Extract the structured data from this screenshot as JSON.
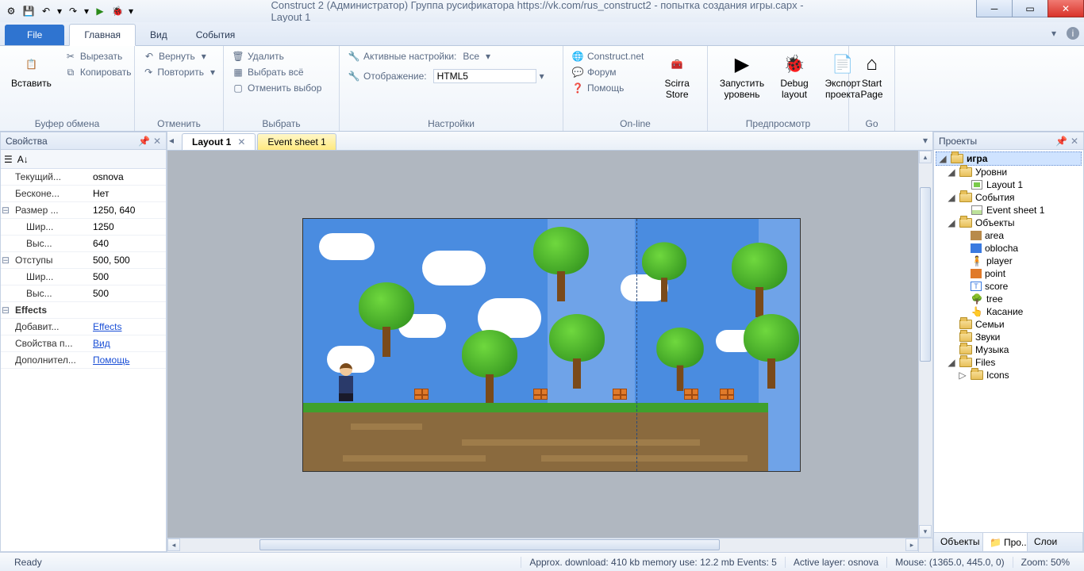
{
  "titlebar": {
    "title": "Construct 2 (Администратор) Группа русификатора https://vk.com/rus_construct2 - попытка создания игры.capx - Layout 1"
  },
  "ribbon_tabs": {
    "file": "File",
    "home": "Главная",
    "view": "Вид",
    "events": "События"
  },
  "ribbon": {
    "clipboard": {
      "paste": "Вставить",
      "cut": "Вырезать",
      "copy": "Копировать",
      "label": "Буфер обмена"
    },
    "undo_grp": {
      "undo": "Вернуть",
      "redo": "Повторить",
      "label": "Отменить"
    },
    "select_grp": {
      "delete": "Удалить",
      "select_all": "Выбрать всё",
      "deselect": "Отменить выбор",
      "label": "Выбрать"
    },
    "settings_grp": {
      "active_cfg_label": "Активные настройки:",
      "active_cfg_val": "Все",
      "display_label": "Отображение:",
      "display_val": "HTML5",
      "label": "Настройки"
    },
    "online_grp": {
      "construct_net": "Construct.net",
      "forum": "Форум",
      "help": "Помощь",
      "store": "Scirra Store",
      "label": "On-line"
    },
    "preview_grp": {
      "run": "Запустить уровень",
      "debug": "Debug layout",
      "export": "Экспорт проекта",
      "label": "Предпросмотр"
    },
    "go_grp": {
      "start": "Start Page",
      "label": "Go"
    }
  },
  "props_panel": {
    "title": "Свойства",
    "rows": {
      "current": {
        "k": "Текущий...",
        "v": "osnova"
      },
      "unbounded": {
        "k": "Бесконе...",
        "v": "Нет"
      },
      "size": {
        "k": "Размер ...",
        "v": "1250, 640"
      },
      "width": {
        "k": "Шир...",
        "v": "1250"
      },
      "height": {
        "k": "Выс...",
        "v": "640"
      },
      "margins": {
        "k": "Отступы",
        "v": "500, 500"
      },
      "mwidth": {
        "k": "Шир...",
        "v": "500"
      },
      "mheight": {
        "k": "Выс...",
        "v": "500"
      },
      "effects_cat": {
        "k": "Effects"
      },
      "add_effect": {
        "k": "Добавит...",
        "v": "Effects"
      },
      "proj_props": {
        "k": "Свойства п...",
        "v": "Вид"
      },
      "more": {
        "k": "Дополнител...",
        "v": "Помощь"
      }
    }
  },
  "doctabs": {
    "layout": "Layout 1",
    "eventsheet": "Event sheet 1"
  },
  "projects_panel": {
    "title": "Проекты",
    "root": "игра",
    "levels": "Уровни",
    "layout1": "Layout 1",
    "events": "События",
    "es1": "Event sheet 1",
    "objects": "Объекты",
    "obj": {
      "area": "area",
      "oblocha": "oblocha",
      "player": "player",
      "point": "point",
      "score": "score",
      "tree": "tree",
      "touch": "Касание"
    },
    "families": "Семьи",
    "sounds": "Звуки",
    "music": "Музыка",
    "files": "Files",
    "icons": "Icons",
    "tab_objects": "Объекты",
    "tab_proj": "Про...",
    "tab_layers": "Слои"
  },
  "statusbar": {
    "ready": "Ready",
    "approx": "Approx. download: 410 kb   memory use: 12.2 mb   Events: 5",
    "layer": "Active layer: osnova",
    "mouse": "Mouse: (1365.0, 445.0, 0)",
    "zoom": "Zoom: 50%"
  }
}
